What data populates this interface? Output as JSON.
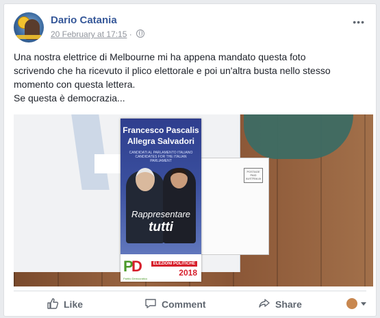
{
  "post": {
    "author": "Dario Catania",
    "date": "20 February at 17:15",
    "separator": "·",
    "privacy_icon": "globe-icon",
    "menu_glyph": "•••",
    "text_lines": [
      "Una nostra elettrice di Melbourne mi ha appena mandato questa foto",
      "scrivendo che ha ricevuto il plico elettorale e poi un'altra busta nello stesso",
      "momento con questa lettera.",
      "Se questa è democrazia..."
    ]
  },
  "photo": {
    "leaflet_name_1": "Francesco Pascalis",
    "leaflet_name_2": "Allegra Salvadori",
    "leaflet_subtitle": "CANDIDATI AL PARLAMENTO ITALIANO CANDIDATES FOR THE ITALIAN PARLIAMENT",
    "slogan_1": "Rappresentare",
    "slogan_2": "tutti",
    "party_logo": "PD",
    "party_name": "Partito Democratico",
    "election_label": "ELEZIONI POLITICHE",
    "election_year": "2018",
    "stamp_text": "POSTAGE PAID AUSTRALIA"
  },
  "actions": {
    "like": "Like",
    "comment": "Comment",
    "share": "Share"
  },
  "colors": {
    "link": "#365899",
    "meta": "#90949c",
    "action": "#606770",
    "pd_green": "#4c9a2a",
    "pd_red": "#d61e2b"
  }
}
